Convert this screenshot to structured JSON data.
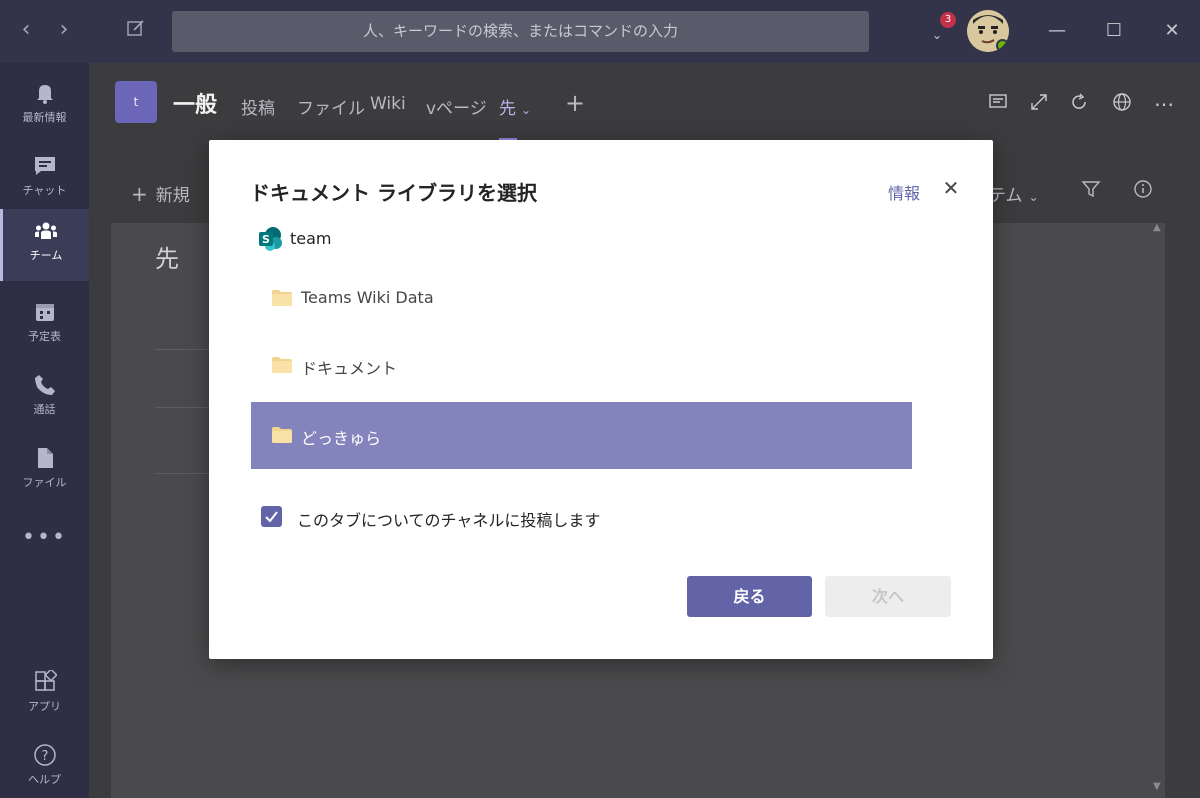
{
  "titlebar": {
    "search_placeholder": "人、キーワードの検索、またはコマンドの入力",
    "notification_count": "3",
    "back_icon": "chevron-left-icon",
    "forward_icon": "chevron-right-icon",
    "compose_icon": "compose-icon"
  },
  "rail": {
    "items": [
      {
        "label": "最新情報",
        "icon": "bell-icon"
      },
      {
        "label": "チャット",
        "icon": "chat-icon"
      },
      {
        "label": "チーム",
        "icon": "teams-icon"
      },
      {
        "label": "予定表",
        "icon": "calendar-icon"
      },
      {
        "label": "通話",
        "icon": "phone-icon"
      },
      {
        "label": "ファイル",
        "icon": "file-icon"
      },
      {
        "label": "アプリ",
        "icon": "apps-icon"
      },
      {
        "label": "ヘルプ",
        "icon": "help-icon"
      }
    ],
    "more": "•••"
  },
  "channel": {
    "team_initial": "t",
    "title": "一般",
    "tabs": [
      "投稿",
      "ファイル",
      "Wiki",
      "vページ",
      "先"
    ],
    "add_tab": "+"
  },
  "content": {
    "new_label": "新規",
    "view_label": "テム",
    "page_title": "先"
  },
  "dialog": {
    "title": "ドキュメント ライブラリを選択",
    "info_link": "情報",
    "site_name": "team",
    "folders": [
      {
        "name": "Teams Wiki Data",
        "selected": false
      },
      {
        "name": "ドキュメント",
        "selected": false
      },
      {
        "name": "どっきゅら",
        "selected": true
      }
    ],
    "post_to_channel_label": "このタブについてのチャネルに投稿します",
    "post_to_channel_checked": true,
    "back_button": "戻る",
    "next_button": "次へ"
  },
  "colors": {
    "accent": "#6264a7",
    "selected_row": "#8484bc",
    "titlebar": "#33344a",
    "rail": "#2e2f45",
    "badge": "#c4314b"
  }
}
